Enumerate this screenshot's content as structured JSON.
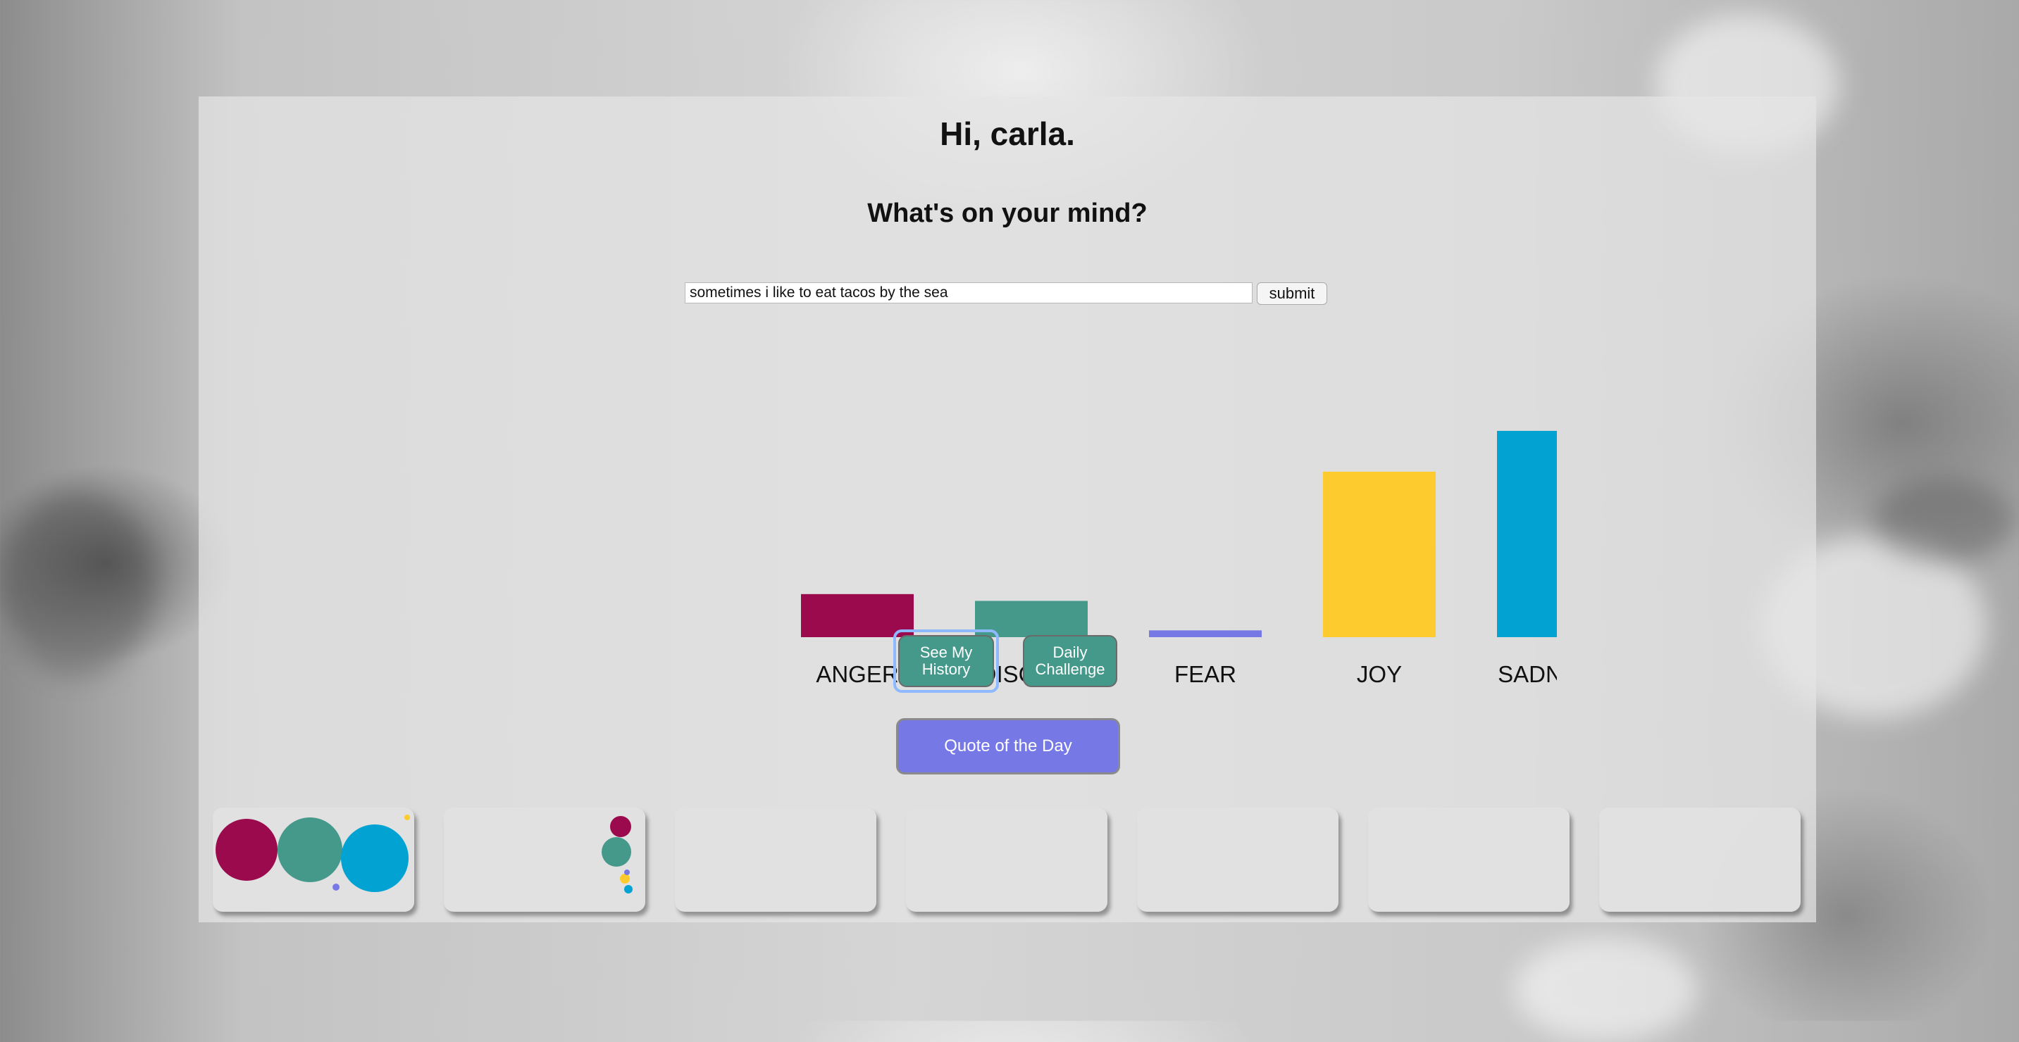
{
  "header": {
    "greeting": "Hi, carla.",
    "prompt": "What's on your mind?"
  },
  "entry": {
    "value": "sometimes i like to eat tacos by the sea",
    "submit_label": "submit"
  },
  "chart_data": {
    "type": "bar",
    "categories": [
      "ANGER",
      "DISGUST",
      "FEAR",
      "JOY",
      "SADNESS"
    ],
    "values": [
      0.19,
      0.16,
      0.03,
      0.73,
      0.91
    ],
    "colors": [
      "#9c0a4e",
      "#44998a",
      "#7678e5",
      "#fdcb2e",
      "#02a2d3"
    ],
    "ylim": [
      0,
      1
    ]
  },
  "buttons": {
    "history_label": "See My History",
    "challenge_label": "Daily Challenge",
    "quote_label": "Quote of the Day"
  },
  "history_cards": [
    {
      "dots": [
        {
          "emotion": "ANGER",
          "color": "#9c0a4e"
        },
        {
          "emotion": "DISGUST",
          "color": "#44998a"
        },
        {
          "emotion": "SADNESS",
          "color": "#02a2d3"
        },
        {
          "emotion": "FEAR",
          "color": "#7678e5"
        },
        {
          "emotion": "JOY",
          "color": "#fdcb2e"
        }
      ]
    },
    {
      "dots": [
        {
          "emotion": "ANGER",
          "color": "#9c0a4e"
        },
        {
          "emotion": "DISGUST",
          "color": "#44998a"
        },
        {
          "emotion": "JOY",
          "color": "#fdcb2e"
        },
        {
          "emotion": "FEAR",
          "color": "#7678e5"
        },
        {
          "emotion": "SADNESS",
          "color": "#02a2d3"
        }
      ]
    },
    {
      "dots": []
    },
    {
      "dots": []
    },
    {
      "dots": []
    },
    {
      "dots": []
    },
    {
      "dots": []
    }
  ]
}
